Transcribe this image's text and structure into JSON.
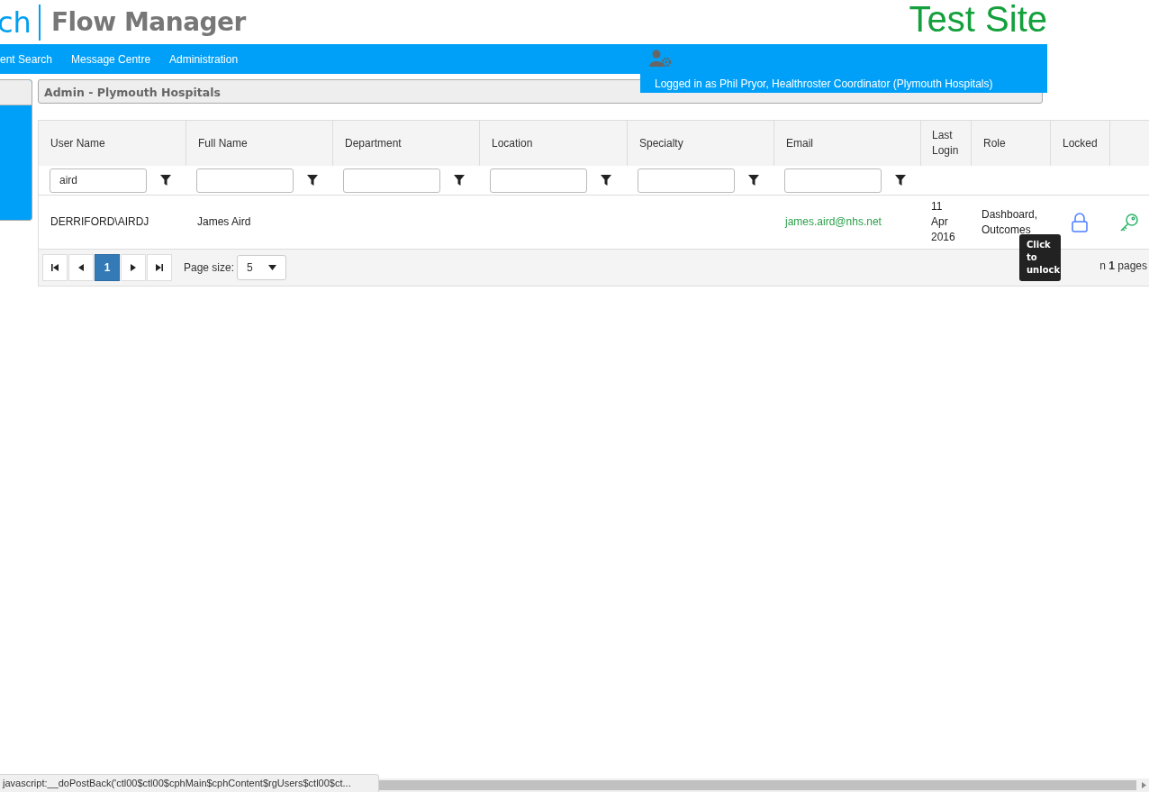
{
  "header": {
    "logo_mark": "ch",
    "logo_title": "Flow Manager",
    "site_label": "Test Site"
  },
  "nav": [
    {
      "label": "ent Search"
    },
    {
      "label": "Message Centre"
    },
    {
      "label": "Administration"
    }
  ],
  "user_banner": {
    "text": "Logged in as Phil Pryor, Healthroster Coordinator (Plymouth Hospitals)"
  },
  "panel": {
    "title": "Admin - Plymouth Hospitals"
  },
  "grid": {
    "columns": [
      {
        "label": "User Name",
        "filterable": true,
        "filter_value": "aird"
      },
      {
        "label": "Full Name",
        "filterable": true
      },
      {
        "label": "Department",
        "filterable": true
      },
      {
        "label": "Location",
        "filterable": true
      },
      {
        "label": "Specialty",
        "filterable": true
      },
      {
        "label": "Email",
        "filterable": true
      },
      {
        "label": "Last Login",
        "filterable": false
      },
      {
        "label": "Role",
        "filterable": false
      },
      {
        "label": "Locked",
        "filterable": false
      },
      {
        "filterable": false
      }
    ],
    "rows": [
      {
        "user_name": "DERRIFORD\\AIRDJ",
        "full_name": "James Aird",
        "email": "james.aird@nhs.net",
        "last_login": "11 Apr 2016",
        "role": "Dashboard, Outcomes",
        "locked": true
      }
    ],
    "pager": {
      "pages": [
        {
          "label": "1",
          "selected": true
        }
      ],
      "page_size_label": "Page size:",
      "page_size": "5",
      "summary": "n **1** pages"
    },
    "tooltip": "Click to unlock"
  },
  "status_bar": {
    "text": "javascript:__doPostBack('ctl00$ctl00$cphMain$cphContent$rgUsers$ctl00$ct..."
  }
}
